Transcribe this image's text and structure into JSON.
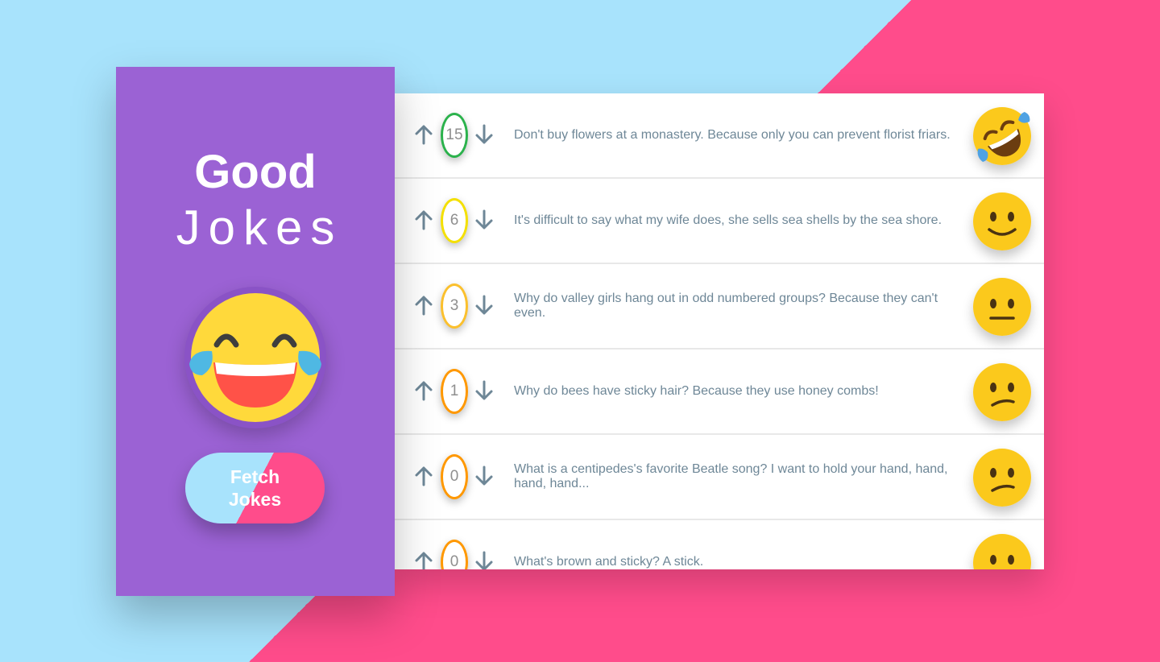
{
  "sidebar": {
    "title_bold": "Good",
    "title_light": "Jokes",
    "emoji_icon": "face-with-tears-of-joy-icon",
    "fetch_button_label": "Fetch Jokes"
  },
  "colors": {
    "background_light": "#a8e3fc",
    "background_pink": "#ff4c8b",
    "sidebar_purple": "#9b62d4",
    "joke_text": "#6e8797"
  },
  "jokes": [
    {
      "score": "15",
      "text": "Don't buy flowers at a monastery. Because only you can prevent florist friars.",
      "badge_color": "#2bb24c",
      "emoji_icon": "rolling-on-floor-laughing-icon"
    },
    {
      "score": "6",
      "text": "It's difficult to say what my wife does, she sells sea shells by the sea shore.",
      "badge_color": "#f4e000",
      "emoji_icon": "slightly-smiling-face-icon"
    },
    {
      "score": "3",
      "text": "Why do valley girls hang out in odd numbered groups? Because they can't even.",
      "badge_color": "#fbc02d",
      "emoji_icon": "neutral-face-icon"
    },
    {
      "score": "1",
      "text": "Why do bees have sticky hair? Because they use honey combs!",
      "badge_color": "#ff9800",
      "emoji_icon": "confused-face-icon"
    },
    {
      "score": "0",
      "text": "What is a centipedes's favorite Beatle song? I want to hold your hand, hand, hand, hand...",
      "badge_color": "#ff9800",
      "emoji_icon": "confused-face-icon"
    },
    {
      "score": "0",
      "text": "What's brown and sticky? A stick.",
      "badge_color": "#ff9800",
      "emoji_icon": "neutral-face-icon"
    }
  ]
}
